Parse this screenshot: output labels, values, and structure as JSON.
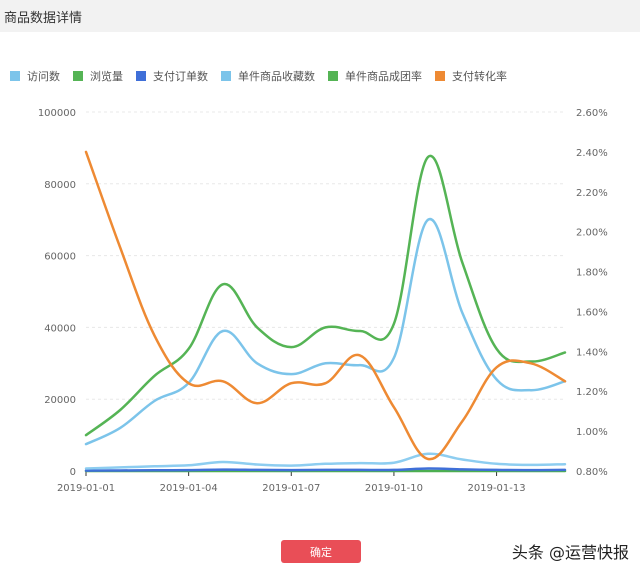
{
  "page_title": "商品数据详情",
  "confirm_label": "确定",
  "watermark": "头条 @运营快报",
  "chart_data": {
    "type": "line",
    "x": [
      "2019-01-01",
      "2019-01-02",
      "2019-01-03",
      "2019-01-04",
      "2019-01-05",
      "2019-01-06",
      "2019-01-07",
      "2019-01-08",
      "2019-01-09",
      "2019-01-10",
      "2019-01-11",
      "2019-01-12",
      "2019-01-13",
      "2019-01-14",
      "2019-01-15"
    ],
    "x_tick_labels": [
      "2019-01-01",
      "2019-01-04",
      "2019-01-07",
      "2019-01-10",
      "2019-01-13"
    ],
    "y_left": {
      "ticks": [
        "0",
        "20000",
        "40000",
        "60000",
        "80000",
        "100000"
      ],
      "ylim": [
        0,
        100000
      ]
    },
    "y_right": {
      "ticks": [
        "0.80%",
        "1.00%",
        "1.20%",
        "1.40%",
        "1.60%",
        "1.80%",
        "2.00%",
        "2.20%",
        "2.40%",
        "2.60%"
      ],
      "ylim": [
        0.8,
        2.6
      ],
      "unit": "%"
    },
    "grid": "horizontal dashed",
    "legend_position": "top-left",
    "series": [
      {
        "name": "访问数",
        "axis": "left",
        "color": "#7cc4ea",
        "legend_color": "#7cc4ea",
        "values": [
          7500,
          12000,
          19500,
          24500,
          39000,
          30000,
          27000,
          30000,
          29500,
          31500,
          70000,
          44000,
          25500,
          22500,
          25000
        ]
      },
      {
        "name": "浏览量",
        "axis": "left",
        "color": "#55b455",
        "legend_color": "#55b455",
        "values": [
          10000,
          17000,
          26500,
          34000,
          52000,
          40000,
          34500,
          40000,
          39000,
          41000,
          87500,
          58000,
          34000,
          30500,
          33000
        ]
      },
      {
        "name": "支付订单数",
        "axis": "left",
        "color": "#3f6fd8",
        "legend_color": "#3f6fd8",
        "values": [
          100,
          150,
          200,
          250,
          400,
          300,
          250,
          300,
          300,
          300,
          700,
          450,
          300,
          250,
          300
        ]
      },
      {
        "name": "单件商品收藏数",
        "axis": "left",
        "color": "#8dcdf0",
        "legend_color": "#7cc4ea",
        "values": [
          700,
          1000,
          1300,
          1600,
          2500,
          1800,
          1500,
          2000,
          2200,
          2300,
          4800,
          3200,
          2000,
          1700,
          1900
        ]
      },
      {
        "name": "单件商品成团率",
        "axis": "left",
        "color": "#4caf50",
        "legend_color": "#55b455",
        "values": [
          0,
          0,
          0,
          0,
          0,
          0,
          0,
          0,
          0,
          0,
          0,
          0,
          0,
          0,
          0
        ]
      },
      {
        "name": "支付转化率",
        "axis": "right",
        "color": "#ee8a33",
        "legend_color": "#ee8a33",
        "values": [
          2.4,
          1.92,
          1.48,
          1.24,
          1.25,
          1.14,
          1.24,
          1.24,
          1.38,
          1.12,
          0.86,
          1.05,
          1.32,
          1.34,
          1.25
        ]
      }
    ]
  }
}
